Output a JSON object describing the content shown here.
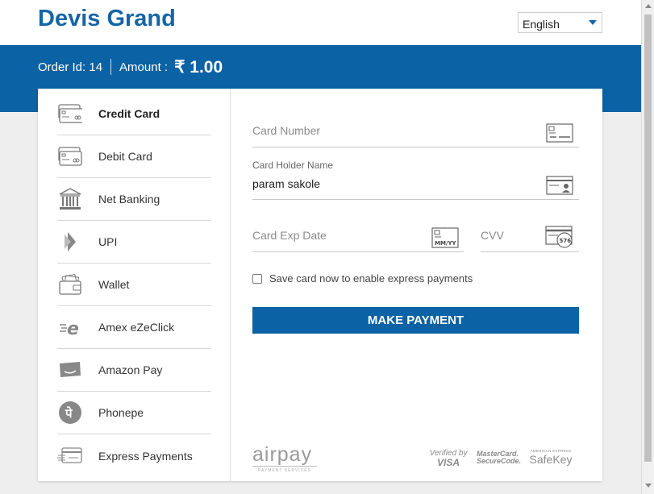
{
  "header": {
    "brand": "Devis Grand",
    "language": {
      "selected": "English"
    }
  },
  "order": {
    "order_label": "Order Id:",
    "order_id": "14",
    "amount_label": "Amount :",
    "amount_value": "₹ 1.00"
  },
  "sidebar": {
    "items": [
      {
        "label": "Credit Card",
        "icon": "credit-card-icon",
        "active": true
      },
      {
        "label": "Debit Card",
        "icon": "debit-card-icon",
        "active": false
      },
      {
        "label": "Net Banking",
        "icon": "bank-icon",
        "active": false
      },
      {
        "label": "UPI",
        "icon": "upi-icon",
        "active": false
      },
      {
        "label": "Wallet",
        "icon": "wallet-icon",
        "active": false
      },
      {
        "label": "Amex eZeClick",
        "icon": "amex-ezeclick-icon",
        "active": false
      },
      {
        "label": "Amazon Pay",
        "icon": "amazon-pay-icon",
        "active": false
      },
      {
        "label": "Phonepe",
        "icon": "phonepe-icon",
        "active": false
      },
      {
        "label": "Express Payments",
        "icon": "express-payments-icon",
        "active": false
      }
    ]
  },
  "form": {
    "card_number": {
      "placeholder": "Card Number",
      "value": ""
    },
    "card_holder": {
      "label": "Card Holder Name",
      "value": "param sakole"
    },
    "exp_date": {
      "placeholder": "Card Exp Date",
      "icon_text": "MM/YY"
    },
    "cvv": {
      "placeholder": "CVV",
      "icon_text": "576"
    },
    "save_card": {
      "label": "Save card now to enable express payments",
      "checked": false
    },
    "pay_button": "MAKE PAYMENT"
  },
  "footer": {
    "airpay": {
      "name": "airpay",
      "tagline": "PAYMENT SERVICES"
    },
    "badges": {
      "visa_top": "Verified by",
      "visa_bottom": "VISA",
      "mc_top": "MasterCard.",
      "mc_bottom": "SecureCode.",
      "amex_top": "AMERICAN EXPRESS",
      "amex_bottom": "SafeKey"
    }
  },
  "colors": {
    "brand_blue": "#0b62a4",
    "brand_text": "#1565a7"
  }
}
